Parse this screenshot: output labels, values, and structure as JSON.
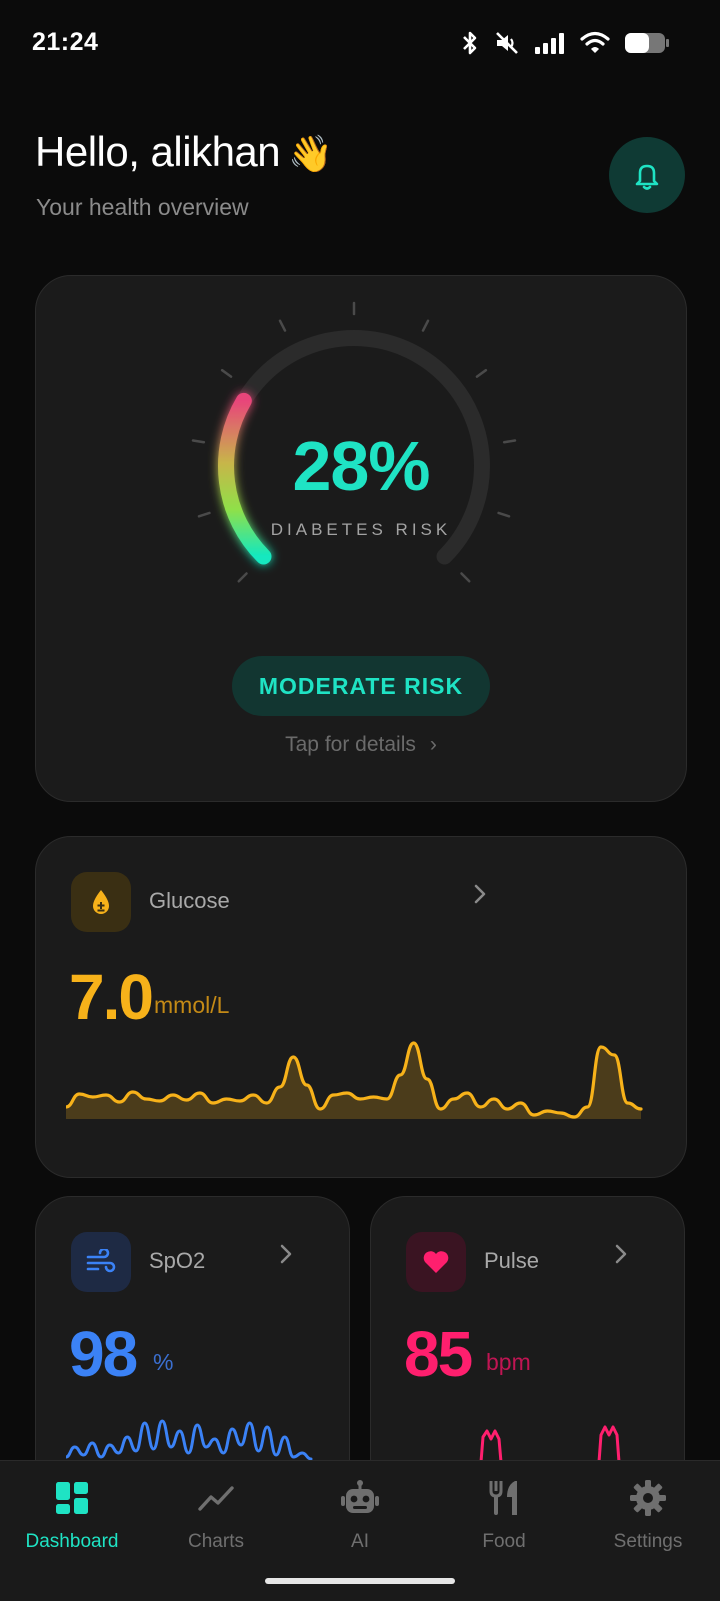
{
  "status_bar": {
    "time": "21:24"
  },
  "header": {
    "greeting": "Hello, alikhan",
    "wave_emoji": "👋",
    "subtitle": "Your health overview",
    "bell_icon": "bell-icon"
  },
  "risk": {
    "value_text": "28%",
    "value": 28,
    "label": "DIABETES RISK",
    "level_label": "MODERATE RISK",
    "details_link": "Tap for details",
    "chevron": "›"
  },
  "glucose": {
    "name": "Glucose",
    "value": "7.0",
    "unit": "mmol/L",
    "icon": "glucose-drop-icon",
    "color": "#f7b21a"
  },
  "spo2": {
    "name": "SpO2",
    "value": "98",
    "unit": "%",
    "icon": "wind-icon",
    "color": "#3b82f6"
  },
  "pulse": {
    "name": "Pulse",
    "value": "85",
    "unit": "bpm",
    "icon": "heart-icon",
    "color": "#ff1f6e"
  },
  "nav": {
    "items": [
      {
        "label": "Dashboard",
        "icon": "dashboard-icon",
        "active": true
      },
      {
        "label": "Charts",
        "icon": "chart-line-icon",
        "active": false
      },
      {
        "label": "AI",
        "icon": "robot-icon",
        "active": false
      },
      {
        "label": "Food",
        "icon": "utensils-icon",
        "active": false
      },
      {
        "label": "Settings",
        "icon": "gear-icon",
        "active": false
      }
    ]
  },
  "colors": {
    "accent": "#1fe3c4",
    "card": "#1b1b1b",
    "background": "#0b0b0b"
  }
}
